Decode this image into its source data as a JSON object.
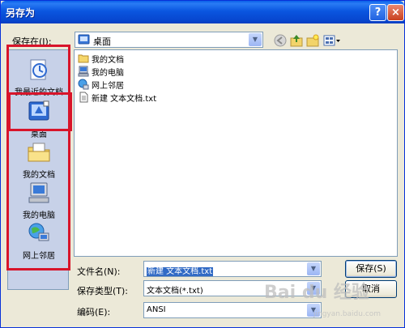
{
  "title": "另存为",
  "titlebar": {
    "help": "?",
    "close": "×"
  },
  "save_in": {
    "label": "保存在(I):",
    "value": "桌面"
  },
  "places": [
    {
      "label": "我最近的文档",
      "icon": "recent-documents-icon"
    },
    {
      "label": "桌面",
      "icon": "desktop-icon"
    },
    {
      "label": "我的文档",
      "icon": "my-documents-icon"
    },
    {
      "label": "我的电脑",
      "icon": "my-computer-icon"
    },
    {
      "label": "网上邻居",
      "icon": "network-places-icon"
    }
  ],
  "files": [
    {
      "label": "我的文档",
      "icon": "folder-icon"
    },
    {
      "label": "我的电脑",
      "icon": "computer-icon"
    },
    {
      "label": "网上邻居",
      "icon": "network-icon"
    },
    {
      "label": "新建 文本文档.txt",
      "icon": "text-file-icon"
    }
  ],
  "filename": {
    "label": "文件名(N):",
    "value": "新建 文本文档.txt"
  },
  "filetype": {
    "label": "保存类型(T):",
    "value": "文本文档(*.txt)"
  },
  "encoding": {
    "label": "编码(E):",
    "value": "ANSI"
  },
  "buttons": {
    "save": "保存(S)",
    "cancel": "取消"
  },
  "watermark": {
    "text": "Bai du 经验",
    "sub": "jingyan.baidu.com"
  },
  "colors": {
    "highlight": "#d8142a",
    "titlebar": "#0a56e0",
    "places_bg": "#c7d1e8"
  }
}
